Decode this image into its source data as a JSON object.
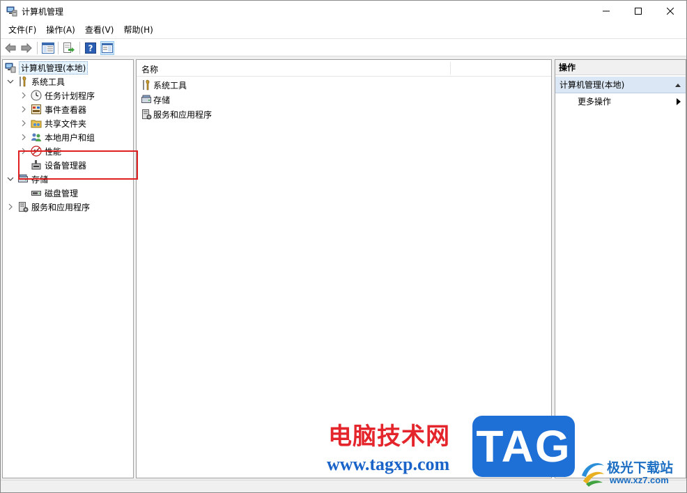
{
  "window": {
    "title": "计算机管理"
  },
  "menu": [
    "文件(F)",
    "操作(A)",
    "查看(V)",
    "帮助(H)"
  ],
  "tree": {
    "root": "计算机管理(本地)",
    "system_tools": "系统工具",
    "task_scheduler": "任务计划程序",
    "event_viewer": "事件查看器",
    "shared_folders": "共享文件夹",
    "local_users": "本地用户和组",
    "performance": "性能",
    "device_manager": "设备管理器",
    "storage": "存储",
    "disk_management": "磁盘管理",
    "services_apps": "服务和应用程序"
  },
  "list": {
    "column_name": "名称",
    "items": [
      "系统工具",
      "存储",
      "服务和应用程序"
    ]
  },
  "actions": {
    "header": "操作",
    "section": "计算机管理(本地)",
    "more": "更多操作"
  },
  "watermark": {
    "cn_text": "电脑技术网",
    "url": "www.tagxp.com",
    "tag": "TAG",
    "site_cn": "极光下载站",
    "site_en": "www.xz7.com"
  },
  "colors": {
    "highlight": "#e02020",
    "selection": "#e5f3ff",
    "ops_section": "#dbe7f4"
  }
}
